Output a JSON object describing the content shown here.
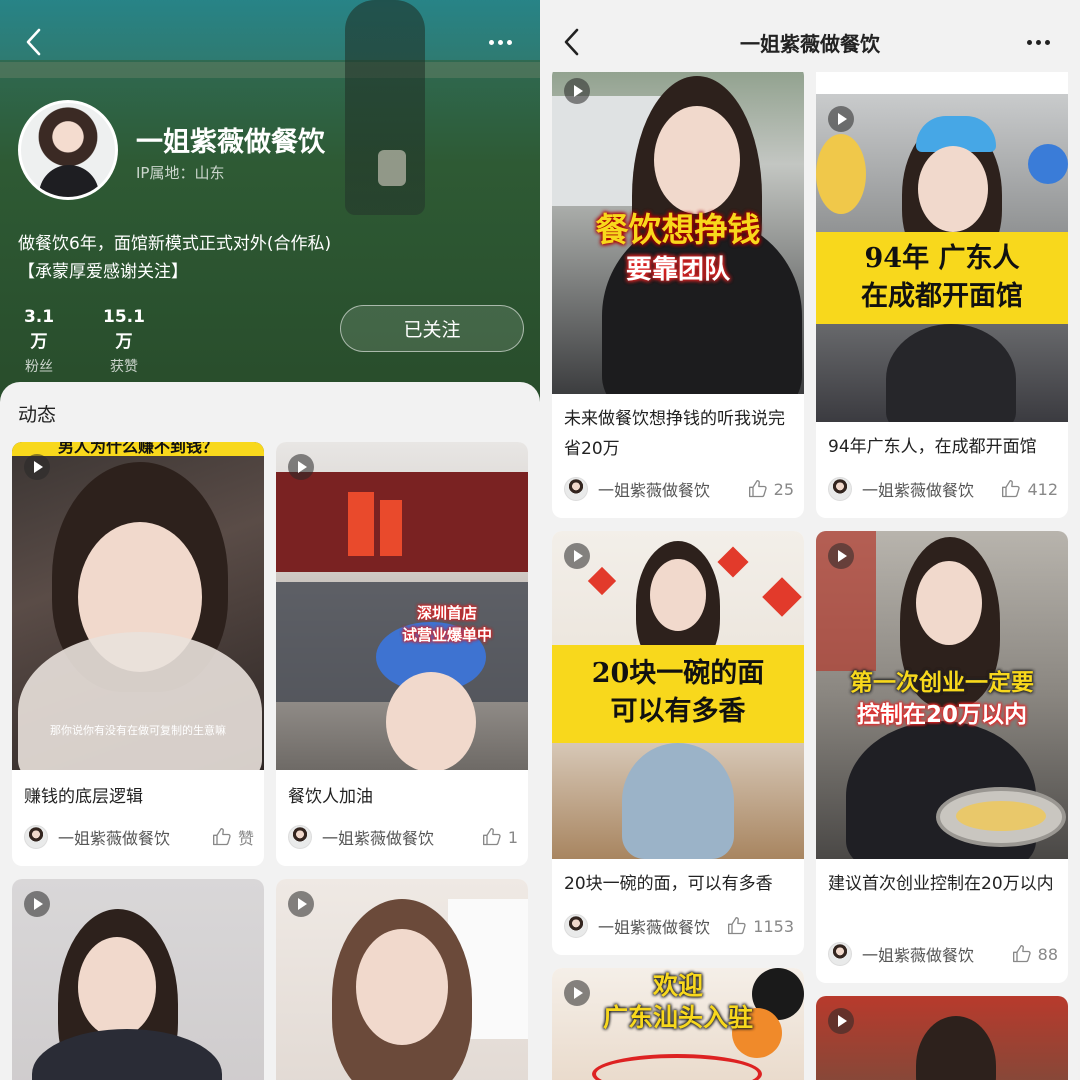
{
  "profile": {
    "name": "一姐紫薇做餐饮",
    "ip_location": "IP属地：山东",
    "bio_line1": "做餐饮6年，面馆新模式正式对外(合作私)",
    "bio_line2": "【承蒙厚爱感谢关注】",
    "fans_count": "3.1万",
    "fans_label": "粉丝",
    "likes_count": "15.1万",
    "likes_label": "获赞",
    "follow_button": "已关注",
    "section_title": "动态"
  },
  "left_feed": [
    {
      "thumb_caption_top": "男人为什么赚不到钱？",
      "thumb_subtitle": "那你说你有没有在做可复制的生意嘛",
      "title": "赚钱的底层逻辑",
      "author": "一姐紫薇做餐饮",
      "likes": "赞"
    },
    {
      "thumb_caption_line1": "深圳首店",
      "thumb_caption_line2": "试营业爆单中",
      "title": "餐饮人加油",
      "author": "一姐紫薇做餐饮",
      "likes": "1"
    }
  ],
  "right_header": {
    "title": "一姐紫薇做餐饮"
  },
  "right_feed": [
    {
      "thumb_caption_line1": "餐饮想挣钱",
      "thumb_caption_line2": "要靠团队",
      "title": "未来做餐饮想挣钱的听我说完省20万",
      "author": "一姐紫薇做餐饮",
      "likes": "25"
    },
    {
      "thumb_caption_line1": "94年 广东人",
      "thumb_caption_line2": "在成都开面馆",
      "title": "94年广东人，在成都开面馆",
      "author": "一姐紫薇做餐饮",
      "likes": "412"
    },
    {
      "thumb_caption_line1": "20块一碗的面",
      "thumb_caption_line2": "可以有多香",
      "title": "20块一碗的面，可以有多香",
      "author": "一姐紫薇做餐饮",
      "likes": "1153"
    },
    {
      "thumb_caption_line1": "第一次创业一定要",
      "thumb_caption_line2": "控制在20万以内",
      "title": "建议首次创业控制在20万以内",
      "author": "一姐紫薇做餐饮",
      "likes": "88"
    },
    {
      "thumb_caption_line1": "欢迎",
      "thumb_caption_line2": "广东汕头入驻"
    }
  ],
  "colors": {
    "yellow_caption": "#f8d81c",
    "red_caption": "#e8312a",
    "hero_green": "#2e5a34"
  },
  "icons": [
    "back-arrow-icon",
    "more-icon",
    "play-icon",
    "thumbs-up-icon"
  ]
}
